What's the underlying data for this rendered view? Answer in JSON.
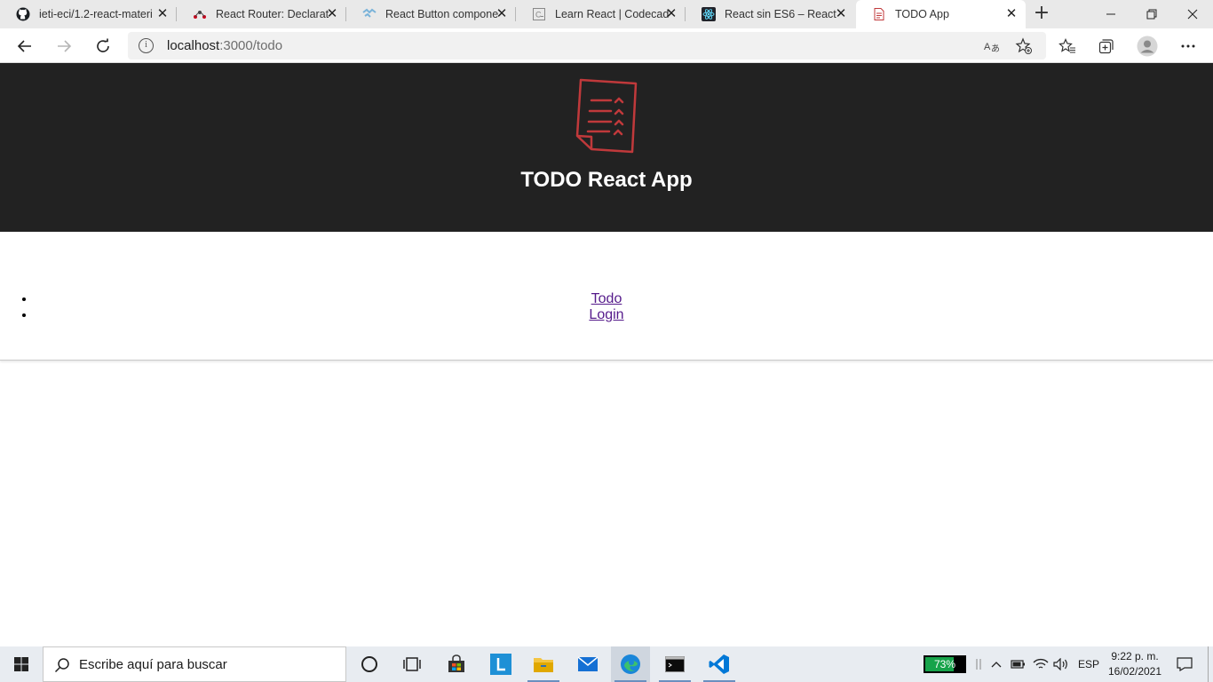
{
  "browser": {
    "tabs": [
      {
        "title": "ieti-eci/1.2-react-materi",
        "icon": "github-icon"
      },
      {
        "title": "React Router: Declarativ",
        "icon": "react-router-icon"
      },
      {
        "title": "React Button componen",
        "icon": "codesandbox-icon"
      },
      {
        "title": "Learn React | Codecade",
        "icon": "codecademy-icon"
      },
      {
        "title": "React sin ES6 – React",
        "icon": "react-icon"
      },
      {
        "title": "TODO App",
        "icon": "document-icon"
      }
    ],
    "active_tab": 5,
    "new_tab_label": "+",
    "address": {
      "host": "localhost",
      "path": ":3000/todo"
    },
    "colors": {
      "tabstrip": "#e9e9e9",
      "toolbar": "#ffffff"
    }
  },
  "app": {
    "title": "TODO React App",
    "logo": "todo-checklist-logo",
    "nav_links": [
      "Todo",
      "Login"
    ],
    "colors": {
      "header_bg": "#222222",
      "logo": "#c0393b",
      "link": "#551a8b"
    }
  },
  "taskbar": {
    "search_placeholder": "Escribe aquí para buscar",
    "battery_percent": 73,
    "battery_label": "73%",
    "language": "ESP",
    "time": "9:22 p. m.",
    "date": "16/02/2021",
    "apps": [
      "start-icon",
      "cortana-icon",
      "task-view-icon",
      "store-icon",
      "lightshot-icon",
      "file-explorer-icon",
      "mail-icon",
      "edge-icon",
      "terminal-icon",
      "vscode-icon"
    ]
  }
}
